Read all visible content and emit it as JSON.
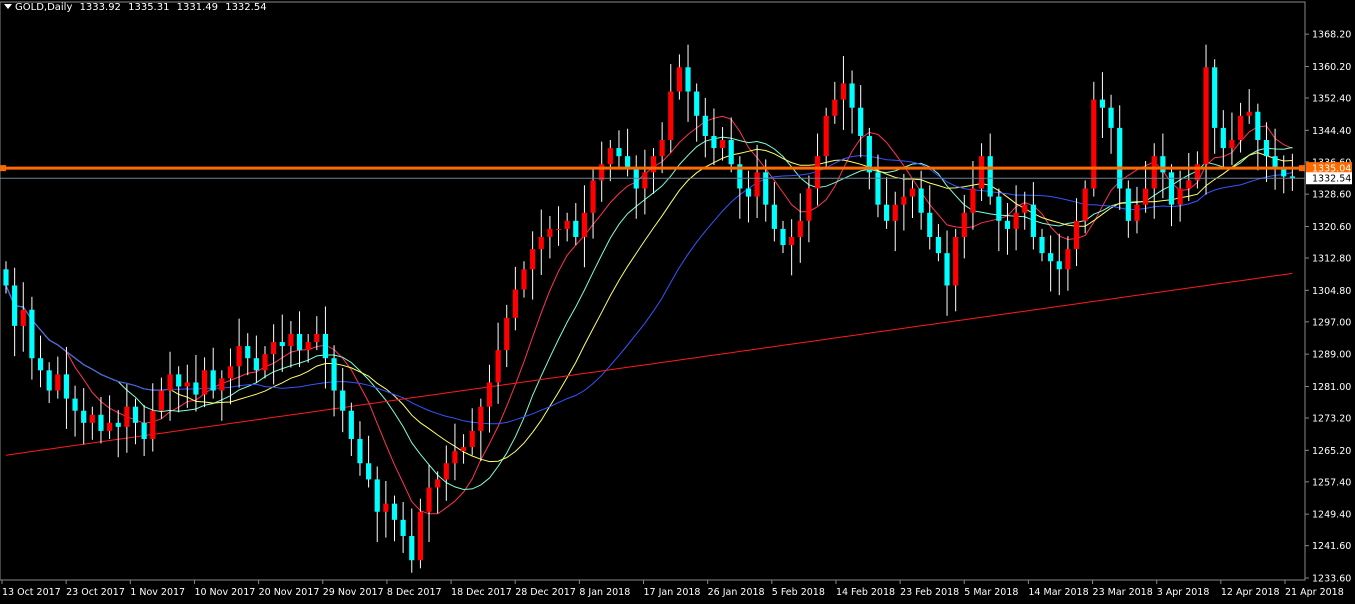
{
  "header": {
    "symbol": "GOLD,Daily",
    "open": "1333.92",
    "high": "1335.31",
    "low": "1331.49",
    "close": "1332.54"
  },
  "colors": {
    "background": "#000000",
    "bull_candle": "#ff0000",
    "bear_candle": "#00ffff",
    "ma_fast": "#ff3355",
    "ma_cyan": "#7fffd4",
    "ma_yellow": "#ffff66",
    "ma_blue": "#3355ff",
    "ma_slow": "#ff1a1a",
    "hline": "#ff6a00",
    "bid_line": "#708090"
  },
  "chart_data": {
    "type": "candlestick",
    "symbol": "GOLD",
    "timeframe": "Daily",
    "ylim": [
      1233.6,
      1372.2
    ],
    "y_ticks": [
      "1368.20",
      "1360.20",
      "1352.40",
      "1344.40",
      "1336.60",
      "1328.60",
      "1320.60",
      "1312.80",
      "1304.80",
      "1297.00",
      "1289.00",
      "1281.00",
      "1273.20",
      "1265.20",
      "1257.40",
      "1249.40",
      "1241.60",
      "1233.60"
    ],
    "x_labels": [
      "13 Oct 2017",
      "23 Oct 2017",
      "1 Nov 2017",
      "10 Nov 2017",
      "20 Nov 2017",
      "29 Nov 2017",
      "8 Dec 2017",
      "18 Dec 2017",
      "28 Dec 2017",
      "8 Jan 2018",
      "17 Jan 2018",
      "26 Jan 2018",
      "5 Feb 2018",
      "14 Feb 2018",
      "23 Feb 2018",
      "5 Mar 2018",
      "14 Mar 2018",
      "23 Mar 2018",
      "3 Apr 2018",
      "12 Apr 2018",
      "21 Apr 2018"
    ],
    "horizontal_line": {
      "price": 1335.04,
      "label": "1335.04"
    },
    "bid_line": {
      "price": 1332.54,
      "label": "1332.54"
    },
    "closes": [
      1306,
      1296,
      1300,
      1288,
      1285,
      1280,
      1284,
      1278,
      1275,
      1272,
      1274,
      1270,
      1272,
      1271,
      1276,
      1272,
      1268,
      1275,
      1280,
      1284,
      1281,
      1282,
      1279,
      1285,
      1280,
      1283,
      1286,
      1291,
      1288,
      1285,
      1289,
      1292,
      1291,
      1294,
      1290,
      1292,
      1294,
      1288,
      1280,
      1275,
      1268,
      1262,
      1258,
      1250,
      1252,
      1248,
      1244,
      1238,
      1250,
      1256,
      1258,
      1262,
      1265,
      1266,
      1270,
      1276,
      1282,
      1290,
      1298,
      1305,
      1310,
      1315,
      1318,
      1320,
      1320,
      1322,
      1318,
      1324,
      1332,
      1336,
      1340,
      1338,
      1335,
      1330,
      1334,
      1338,
      1342,
      1354,
      1360,
      1354,
      1348,
      1343,
      1340,
      1342,
      1336,
      1330,
      1328,
      1334,
      1326,
      1320,
      1316,
      1318,
      1322,
      1330,
      1338,
      1348,
      1352,
      1356,
      1350,
      1343,
      1334,
      1326,
      1322,
      1326,
      1328,
      1330,
      1324,
      1318,
      1314,
      1306,
      1318,
      1324,
      1330,
      1338,
      1328,
      1322,
      1320,
      1324,
      1326,
      1318,
      1314,
      1312,
      1310,
      1315,
      1322,
      1330,
      1352,
      1350,
      1345,
      1330,
      1322,
      1326,
      1330,
      1338,
      1334,
      1326,
      1330,
      1332,
      1336,
      1360,
      1345,
      1340,
      1342,
      1348,
      1349,
      1342,
      1338,
      1335,
      1333,
      1332.5
    ]
  }
}
